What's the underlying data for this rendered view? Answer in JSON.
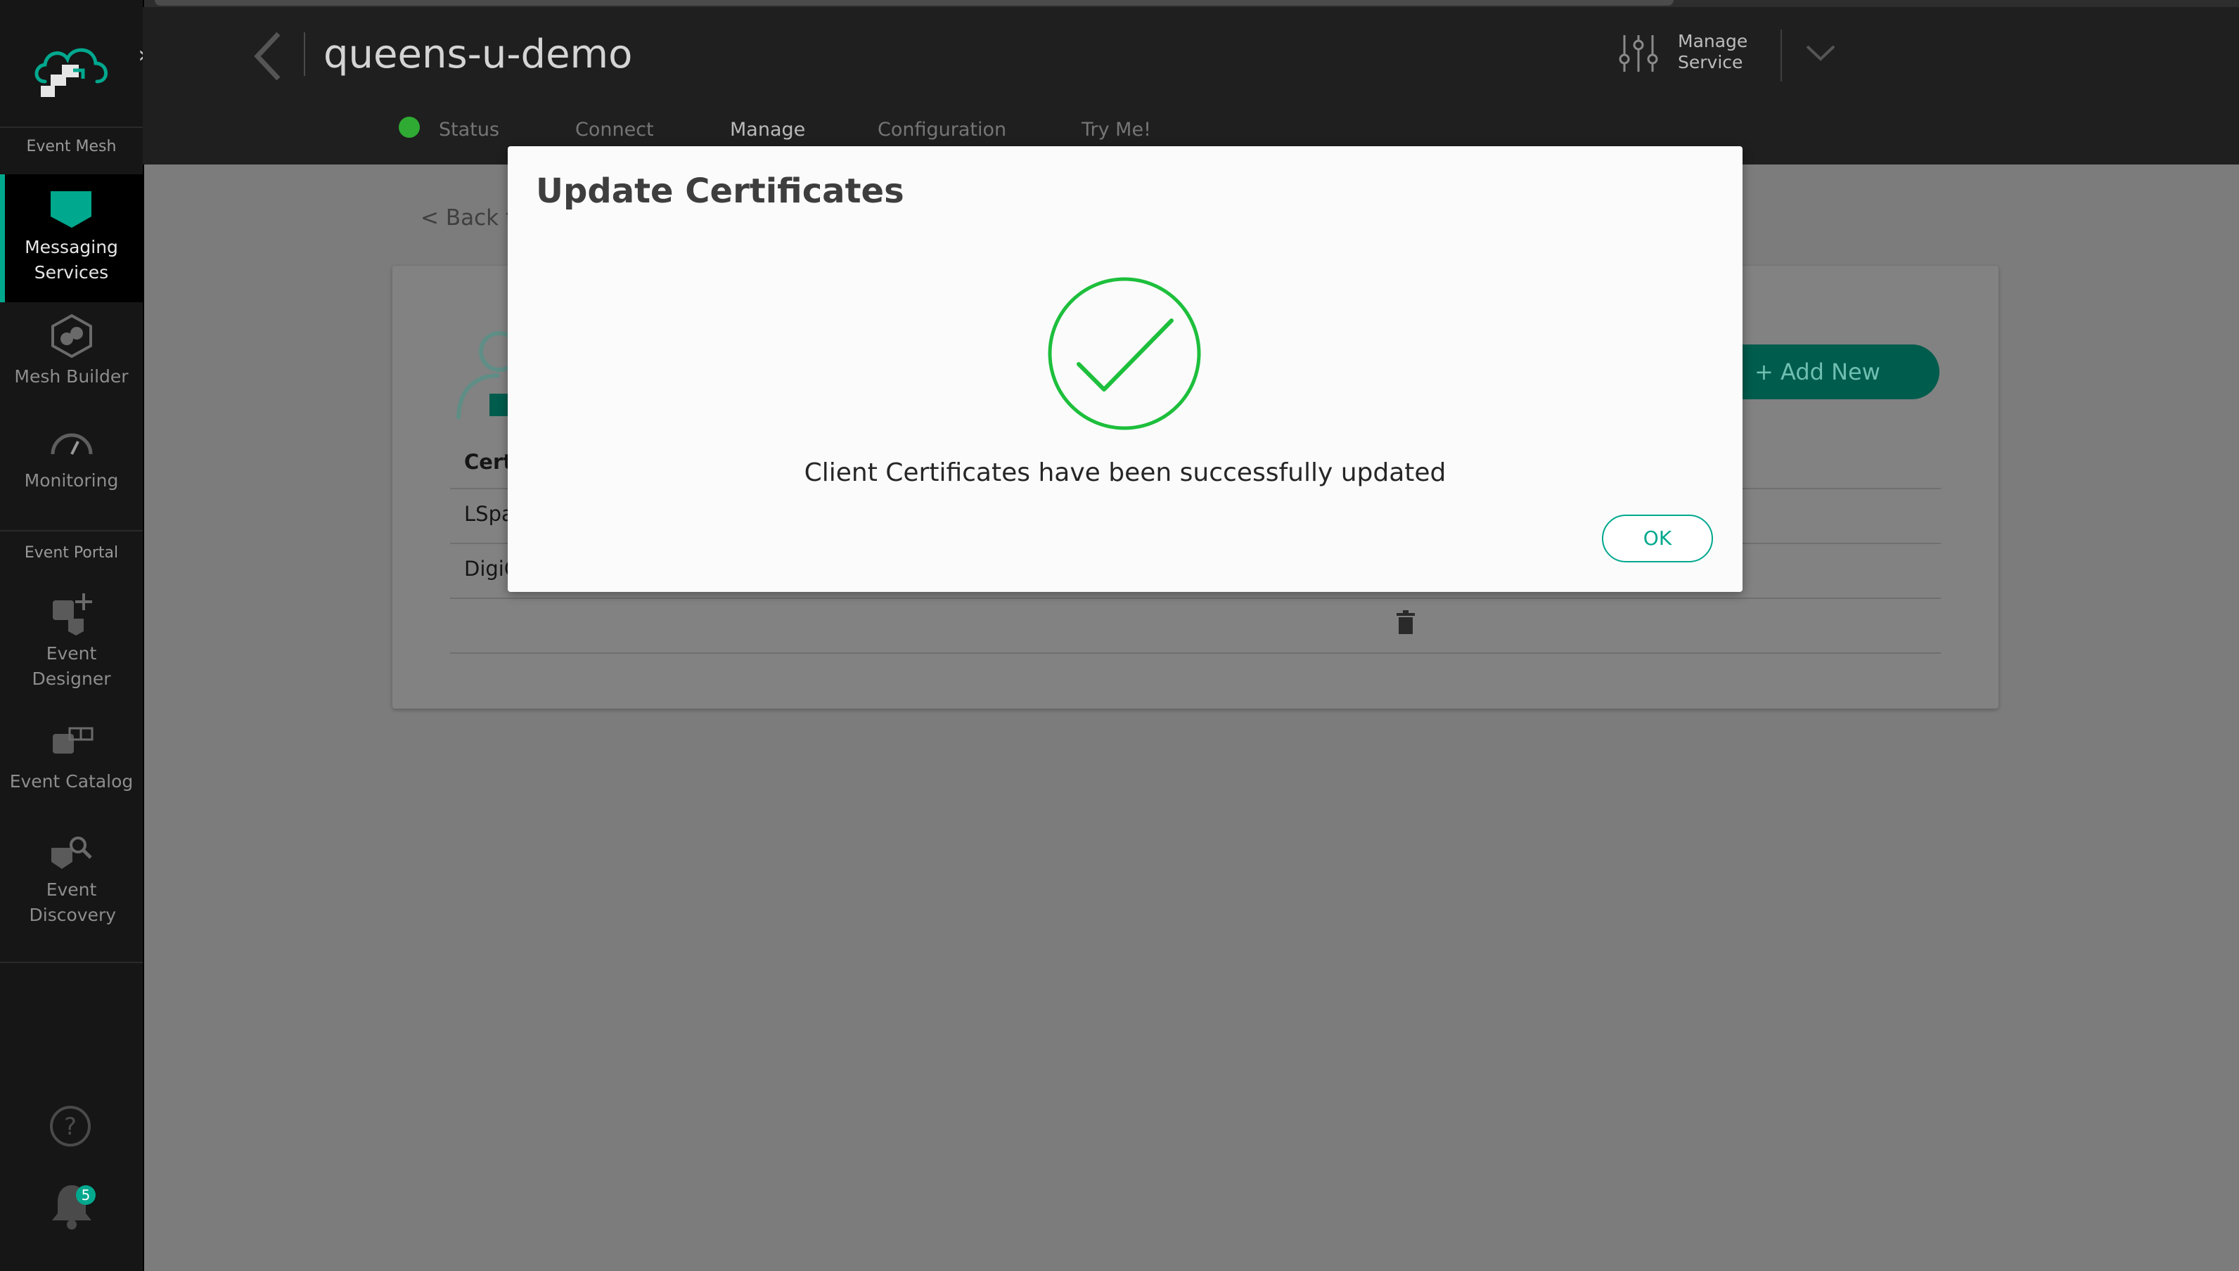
{
  "colors": {
    "accent": "#00a88e",
    "status_green": "#2fab33",
    "success_check": "#1dbf3c",
    "sidebar_bg": "#161616",
    "header_bg": "#1f1f1f"
  },
  "sidebar": {
    "section_event_mesh": "Event Mesh",
    "section_event_portal": "Event Portal",
    "items": [
      {
        "label": "Messaging Services",
        "icon": "messaging-services-icon",
        "active": true
      },
      {
        "label": "Mesh Builder",
        "icon": "mesh-builder-icon"
      },
      {
        "label": "Monitoring",
        "icon": "monitoring-gauge-icon"
      },
      {
        "label": "Event Designer",
        "icon": "event-designer-icon"
      },
      {
        "label": "Event Catalog",
        "icon": "event-catalog-icon"
      },
      {
        "label": "Event Discovery",
        "icon": "event-discovery-icon"
      }
    ],
    "notification_count": "5"
  },
  "header": {
    "service_name": "queens-u-demo",
    "manage_service_line1": "Manage",
    "manage_service_line2": "Service",
    "tabs": [
      "Status",
      "Connect",
      "Manage",
      "Configuration",
      "Try Me!"
    ],
    "active_tab": "Manage"
  },
  "page": {
    "back_link": "< Back t",
    "add_new_label": "+ Add New",
    "table": {
      "header_fragment": "Cert",
      "row_fragments": [
        "LSpa",
        "DigiC"
      ]
    }
  },
  "modal": {
    "title": "Update Certificates",
    "message": "Client Certificates have been successfully updated",
    "ok_label": "OK",
    "icon": "success-checkmark-icon"
  }
}
